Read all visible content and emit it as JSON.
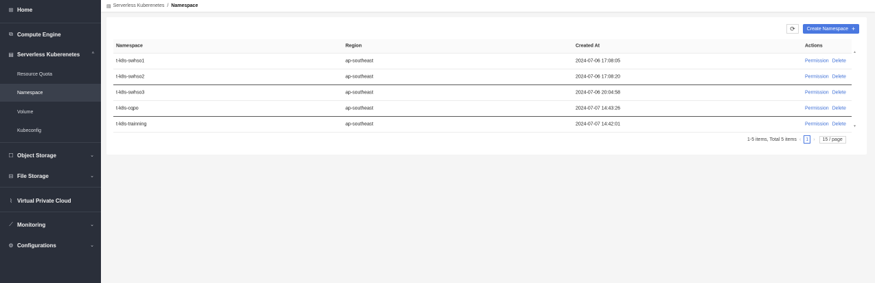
{
  "sidebar": {
    "home": "Home",
    "compute_engine": "Compute Engine",
    "serverless": "Serverless Kuberenetes",
    "sub_items": [
      "Resource Quota",
      "Namespace",
      "Volume",
      "Kubeconfig"
    ],
    "object_storage": "Object Storage",
    "file_storage": "File Storage",
    "vpc": "Virtual Private Cloud",
    "monitoring": "Monitoring",
    "configurations": "Configurations"
  },
  "breadcrumb": {
    "parent": "Serverless Kuberenetes",
    "separator": "/",
    "current": "Namespace"
  },
  "toolbar": {
    "refresh_icon": "⟳",
    "create_label": "Create Namespace"
  },
  "table": {
    "headers": [
      "Namespace",
      "Region",
      "Created At",
      "Actions"
    ],
    "rows": [
      [
        "t-k8s-swhso1",
        "ap-southeast",
        "2024-07-06 17:08:05"
      ],
      [
        "t-k8s-swhso2",
        "ap-southeast",
        "2024-07-06 17:08:20"
      ],
      [
        "t-k8s-swhso3",
        "ap-southeast",
        "2024-07-06 20:04:58"
      ],
      [
        "t-k8s-cqpo",
        "ap-southeast",
        "2024-07-07 14:43:26"
      ],
      [
        "t-k8s-trainning",
        "ap-southeast",
        "2024-07-07 14:42:01"
      ]
    ],
    "action_permission": "Permission",
    "action_delete": "Delete"
  },
  "pagination": {
    "summary": "1-5 items, Total 5 items",
    "current_page": "1",
    "page_size": "15 / page"
  },
  "colors": {
    "sidebar_bg": "#2a2f3a",
    "accent": "#4a78e0"
  }
}
